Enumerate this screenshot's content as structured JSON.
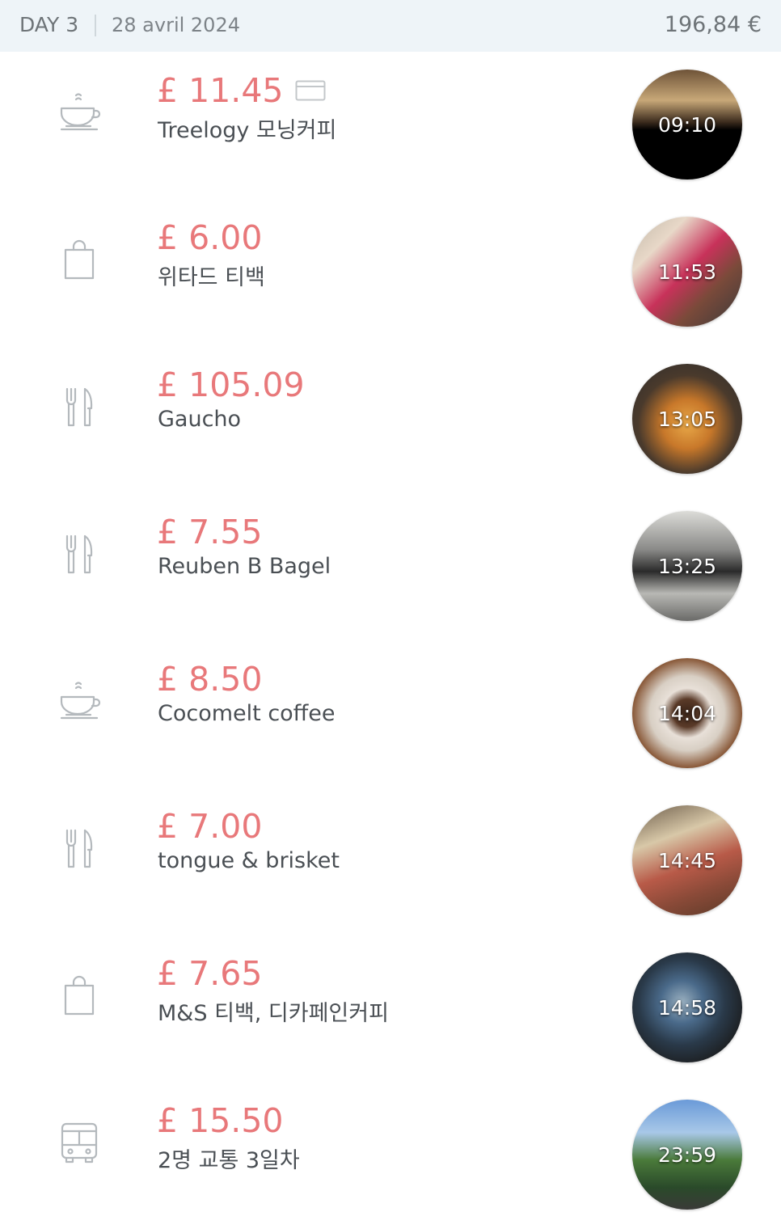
{
  "header": {
    "day": "DAY 3",
    "date": "28 avril 2024",
    "total": "196,84 €"
  },
  "colors": {
    "amount": "#e8787a",
    "label": "#4a4f54",
    "header_bg": "#eef4f8",
    "icon_stroke": "#b4b9bd"
  },
  "expenses": [
    {
      "category_icon": "coffee-cup-icon",
      "amount": "£ 11.45",
      "has_card_icon": true,
      "label": "Treelogy 모닝커피",
      "time": "09:10"
    },
    {
      "category_icon": "shopping-bag-icon",
      "amount": "£ 6.00",
      "label": "위타드 티백",
      "time": "11:53"
    },
    {
      "category_icon": "fork-knife-icon",
      "amount": "£ 105.09",
      "label": "Gaucho",
      "time": "13:05"
    },
    {
      "category_icon": "fork-knife-icon",
      "amount": "£ 7.55",
      "label": "Reuben B Bagel",
      "time": "13:25"
    },
    {
      "category_icon": "coffee-cup-icon",
      "amount": "£ 8.50",
      "label": "Cocomelt coffee",
      "time": "14:04"
    },
    {
      "category_icon": "fork-knife-icon",
      "amount": "£ 7.00",
      "label": "tongue & brisket",
      "time": "14:45"
    },
    {
      "category_icon": "shopping-bag-icon",
      "amount": "£ 7.65",
      "label": "M&S 티백, 디카페인커피",
      "time": "14:58"
    },
    {
      "category_icon": "bus-icon",
      "amount": "£ 15.50",
      "label": "2명 교통 3일차",
      "time": "23:59"
    }
  ]
}
